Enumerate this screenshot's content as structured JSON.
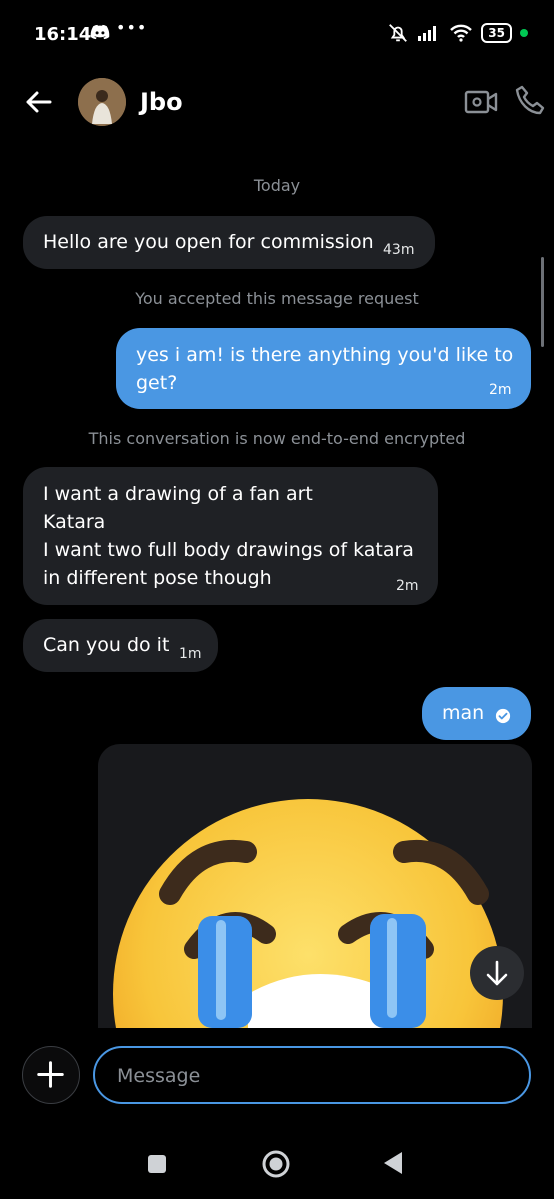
{
  "status_bar": {
    "time": "16:14",
    "dots": "•••",
    "battery": "35"
  },
  "header": {
    "contact_name": "Jbo"
  },
  "chat": {
    "day_label": "Today",
    "messages": [
      {
        "text": "Hello are you open for commission",
        "time": "43m"
      },
      {
        "system": "You accepted this message request"
      },
      {
        "text_lines": [
          "yes i am! is there anything you'd like to",
          "get?"
        ],
        "time": "2m"
      },
      {
        "system": "This conversation is now end-to-end encrypted"
      },
      {
        "text_lines": [
          "I want a drawing of a fan art",
          "Katara",
          "I want two full body drawings of katara",
          "in different pose though"
        ],
        "time": "2m"
      },
      {
        "text": "Can you do it",
        "time": "1m"
      },
      {
        "text": "man"
      }
    ]
  },
  "composer": {
    "placeholder": "Message"
  },
  "colors": {
    "accent": "#4a97e3",
    "incoming_bubble": "#1f2125",
    "background": "#000000"
  }
}
